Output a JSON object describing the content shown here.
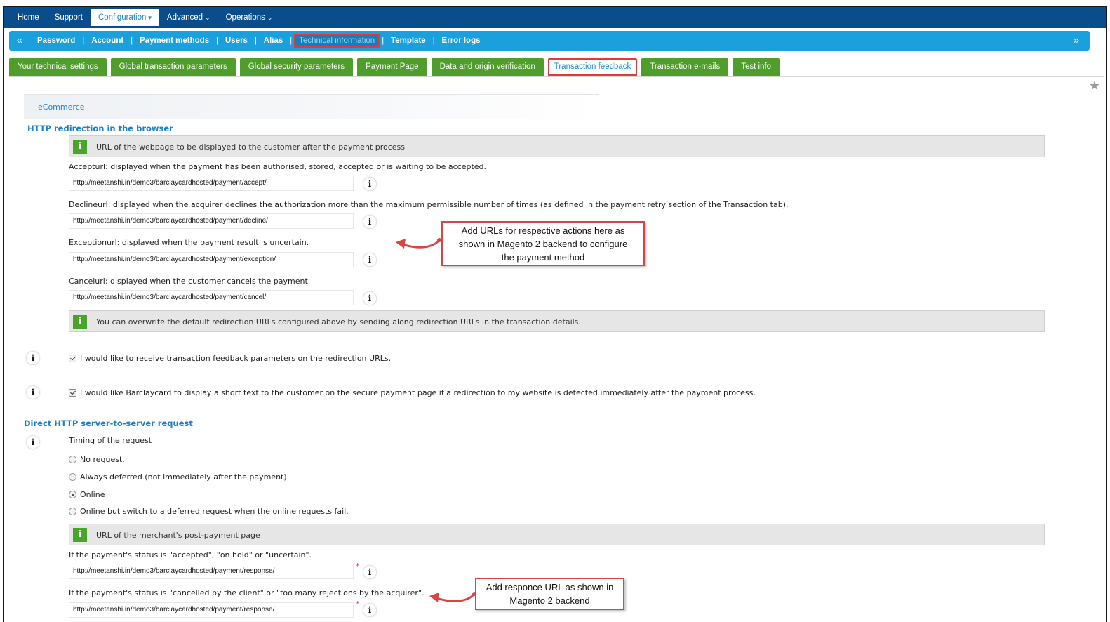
{
  "topnav": {
    "items": [
      "Home",
      "Support",
      "Configuration",
      "Advanced",
      "Operations"
    ]
  },
  "subnav": {
    "left_arrow": "«",
    "right_arrow": "»",
    "links": [
      "Password",
      "Account",
      "Payment methods",
      "Users",
      "Alias",
      "Technical information",
      "Template",
      "Error logs"
    ]
  },
  "tabs": [
    "Your technical settings",
    "Global transaction parameters",
    "Global security parameters",
    "Payment Page",
    "Data and origin verification",
    "Transaction feedback",
    "Transaction e-mails",
    "Test info"
  ],
  "ecommerce_label": "eCommerce",
  "http_redirection": {
    "title": "HTTP redirection in the browser",
    "info_text": "URL of the webpage to be displayed to the customer after the payment process",
    "accept_label": "Accepturl: displayed when the payment has been authorised, stored, accepted or is waiting to be accepted.",
    "accept_url": "http://meetanshi.in/demo3/barclaycardhosted/payment/accept/",
    "decline_label": "Declineurl: displayed when the acquirer declines the authorization more than the maximum permissible number of times (as defined in the payment retry section of the Transaction tab).",
    "decline_url": "http://meetanshi.in/demo3/barclaycardhosted/payment/decline/",
    "exception_label": "Exceptionurl: displayed when the payment result is uncertain.",
    "exception_url": "http://meetanshi.in/demo3/barclaycardhosted/payment/exception/",
    "cancel_label": "Cancelurl: displayed when the customer cancels the payment.",
    "cancel_url": "http://meetanshi.in/demo3/barclaycardhosted/payment/cancel/",
    "overwrite_text": "You can overwrite the default redirection URLs configured above by sending along redirection URLs in the transaction details.",
    "check_feedback": "I would like to receive transaction feedback parameters on the redirection URLs.",
    "check_short_text": "I would like Barclaycard to display a short text to the customer on the secure payment page if a redirection to my website is detected immediately after the payment process."
  },
  "direct_http": {
    "title": "Direct HTTP server-to-server request",
    "timing_label": "Timing of the request",
    "options": [
      "No request.",
      "Always deferred (not immediately after the payment).",
      "Online",
      "Online but switch to a deferred request when the online requests fail."
    ],
    "selected_option": "Online",
    "post_payment_info": "URL of the merchant's post-payment page",
    "status_accepted_label": "If the payment's status is \"accepted\", \"on hold\" or \"uncertain\".",
    "status_accepted_url": "http://meetanshi.in/demo3/barclaycardhosted/payment/response/",
    "status_cancelled_label": "If the payment's status is \"cancelled by the client\" or \"too many rejections by the acquirer\".",
    "status_cancelled_url": "http://meetanshi.in/demo3/barclaycardhosted/payment/response/",
    "required_mark": "*"
  },
  "info_icon": "i",
  "callouts": {
    "urls": [
      "Add URLs for respective actions here as",
      "shown in Magento 2 backend to configure",
      "the payment method"
    ],
    "response": [
      "Add responce URL as shown in",
      "Magento 2 backend"
    ]
  },
  "icons": {
    "star": "star-icon",
    "info": "info-icon",
    "caret": "chevron-down-icon"
  },
  "colors": {
    "topnav_bg": "#0a4d8c",
    "subnav_bg": "#1aa1dd",
    "tab_green": "#4f9e2b",
    "highlight_red": "#e03a3a",
    "link_blue": "#1f7fc4"
  }
}
